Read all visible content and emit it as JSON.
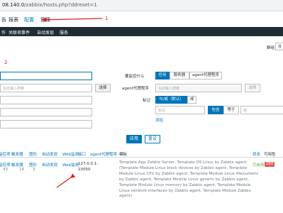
{
  "browser": {
    "url_host": "08.140.0",
    "url_path": "/zabbix/hosts.php?ddreset=1"
  },
  "top_menu": {
    "items": [
      {
        "label": "告"
      },
      {
        "label": "报表"
      },
      {
        "label": "配置"
      },
      {
        "label": "管理"
      }
    ],
    "active": "配置"
  },
  "sub_menu": {
    "items": [
      {
        "label": "作"
      },
      {
        "label": "关联项事件"
      },
      {
        "label": "自动发现"
      },
      {
        "label": "服务"
      }
    ]
  },
  "group_select": {
    "label": "群组",
    "value": "任"
  },
  "filter": {
    "annotation_number": "2",
    "templates_placeholder": "在此输入搜索",
    "select_button": "选择",
    "monitored_by_label": "要监控什么",
    "monitored_by_options": [
      {
        "label": "任何"
      },
      {
        "label": "服务器"
      },
      {
        "label": "agent代理程序"
      }
    ],
    "proxy_label": "agent代理程序",
    "proxy_placeholder": "在此输入搜索",
    "proxy_select_button": "选择",
    "tags_label": "标记",
    "tags_logic_options": [
      {
        "label": "与/或（默认）"
      },
      {
        "label": "或"
      }
    ],
    "tag_placeholder": "标记",
    "tag_operator_options": [
      {
        "label": "包含"
      },
      {
        "label": "等于"
      }
    ],
    "tag_value_placeholder": "值",
    "add_link": "添加",
    "apply_button": "应用",
    "reset_button": "重设"
  },
  "annotations": {
    "one": "1",
    "two": "2"
  },
  "table": {
    "headers": [
      "监控项",
      "触发器",
      "图形",
      "自动发现",
      "Web监测",
      "接口",
      "agent代理程序",
      "模板",
      "状态",
      "可用性"
    ],
    "row": {
      "items_link": "监控项",
      "items_count": "43",
      "triggers_link": "触发器",
      "triggers_count": "14",
      "graphs_link": "图形",
      "graphs_count": "3",
      "discovery_link": "自动发现",
      "web_link": "Web监测",
      "interface_line1": "127.0.0.1:",
      "interface_line2": "10050",
      "status": "已启用",
      "zbx_badge": "ZBX",
      "templates": [
        "Template App Zabbix Server, Template OS Linux by Zabbix agent",
        "(Template Module Linux block devices by Zabbix agent, Template",
        "Module Linux CPU by Zabbix agent, Template Module Linux filesystems",
        "by Zabbix agent, Template Module Linux generic by Zabbix agent,",
        "Template Module Linux memory by Zabbix agent, Template Module",
        "Linux network interfaces by Zabbix agent, Template Module Zabbix",
        "agent)"
      ]
    }
  },
  "colors": {
    "accent": "#0275b8",
    "dark_nav": "#1f2c33",
    "annotation_red": "#e02020",
    "status_green": "#59a830",
    "zbx_red": "#e45959"
  }
}
